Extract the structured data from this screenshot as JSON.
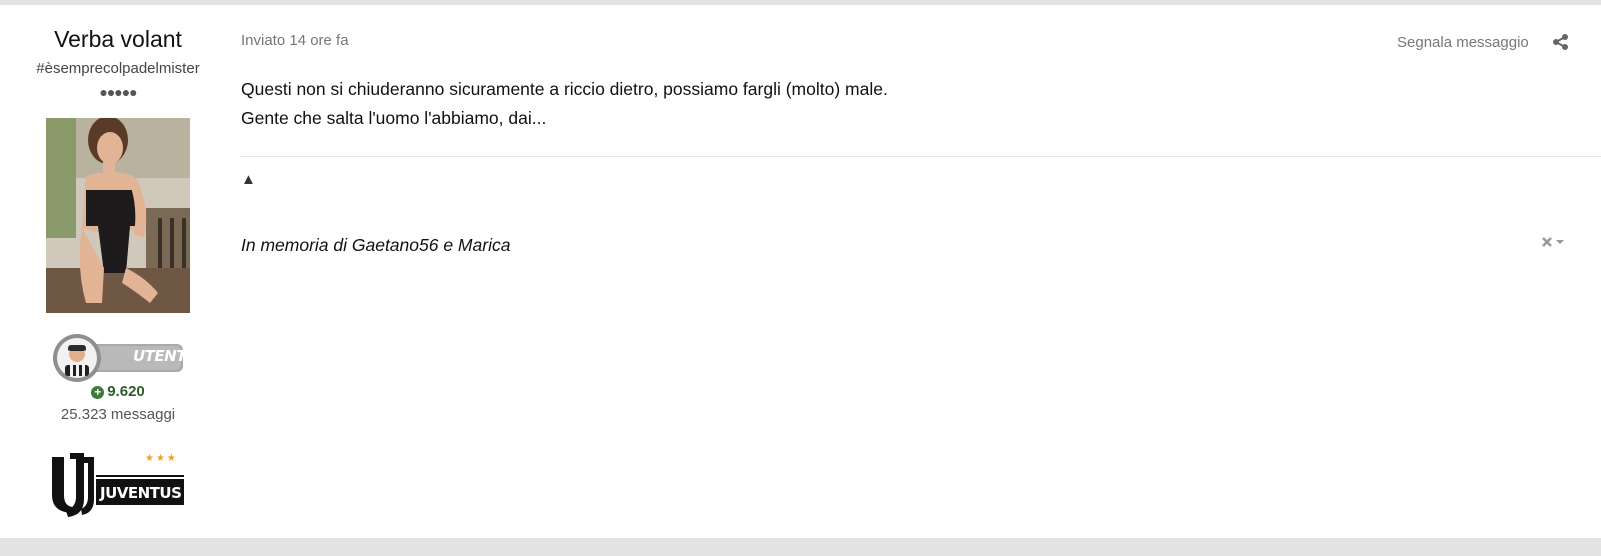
{
  "author": {
    "name": "Verba volant",
    "title": "#èsemprecolpadelmister",
    "rank_pips": "●●●●●",
    "group_label": "UTENTE",
    "reputation": "9.620",
    "post_count": "25.323 messaggi",
    "team_label": "JUVENTUS",
    "team_stars": "★★★"
  },
  "post": {
    "date": "Inviato 14 ore fa",
    "report_label": "Segnala messaggio",
    "body_lines": [
      "Questi non si chiuderanno sicuramente a riccio dietro, possiamo fargli (molto) male.",
      "Gente che salta l'uomo l'abbiamo, dai..."
    ],
    "signature_toggle": "▲",
    "signature": "In memoria di Gaetano56 e Marica"
  },
  "icons": {
    "share": "share-icon",
    "reputation": "plus-circle-icon",
    "signature_menu": "close-icon"
  },
  "colors": {
    "reputation": "#2f5d2a",
    "frame": "#e3e3e3",
    "muted_text": "#777777"
  }
}
